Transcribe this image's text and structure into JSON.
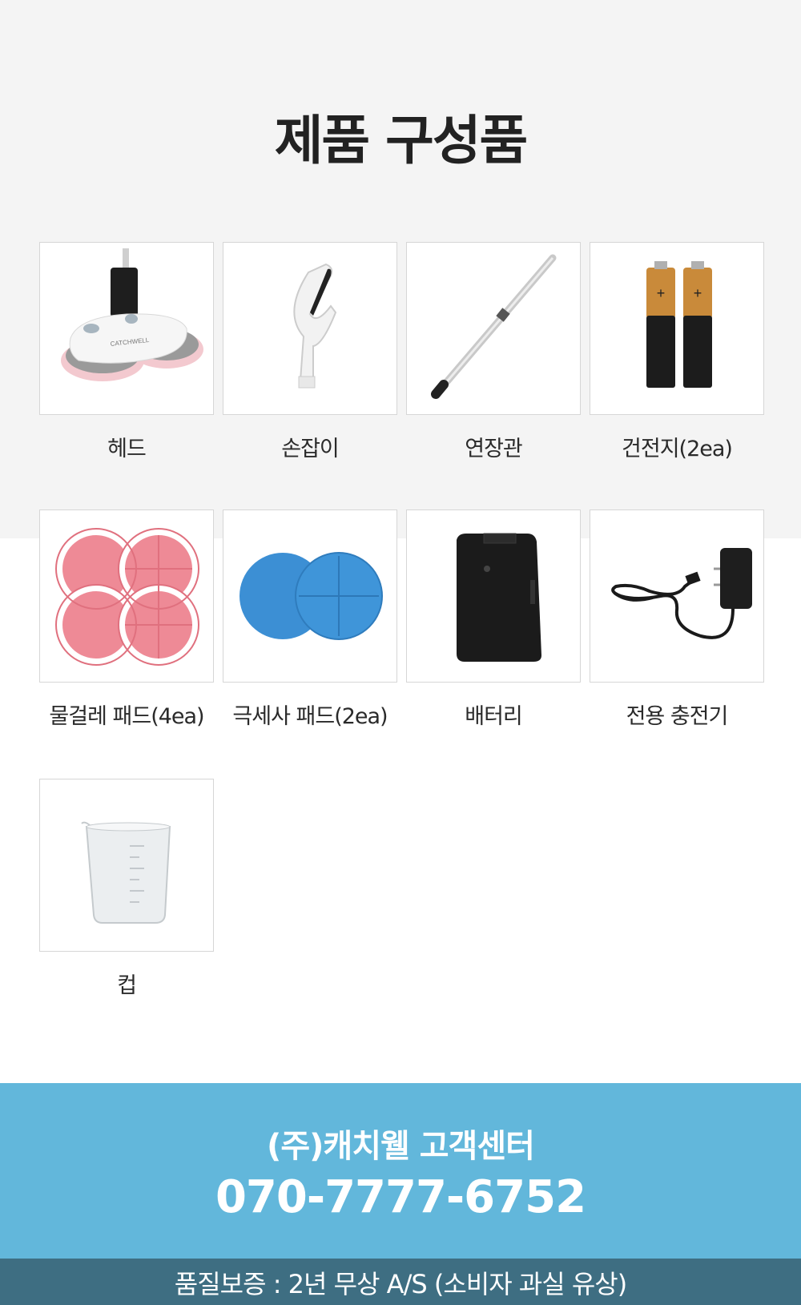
{
  "section": {
    "title": "제품 구성품"
  },
  "components": [
    {
      "label": "헤드",
      "icon": "mop-head-icon"
    },
    {
      "label": "손잡이",
      "icon": "handle-icon"
    },
    {
      "label": "연장관",
      "icon": "extension-pipe-icon"
    },
    {
      "label": "건전지(2ea)",
      "icon": "battery-cells-icon"
    },
    {
      "label": "물걸레 패드(4ea)",
      "icon": "wet-pad-icon"
    },
    {
      "label": "극세사 패드(2ea)",
      "icon": "microfiber-pad-icon"
    },
    {
      "label": "배터리",
      "icon": "battery-pack-icon"
    },
    {
      "label": "전용 충전기",
      "icon": "charger-icon"
    },
    {
      "label": "컵",
      "icon": "measuring-cup-icon"
    }
  ],
  "customer_center": {
    "title": "(주)캐치웰 고객센터",
    "phone": "070-7777-6752",
    "warranty": "품질보증 : 2년 무상 A/S (소비자 과실 유상)"
  },
  "colors": {
    "top_background": "#f4f4f4",
    "customer_center_background": "#62b7db",
    "warranty_background": "#3e6e82",
    "card_border": "#d6d6d6"
  }
}
